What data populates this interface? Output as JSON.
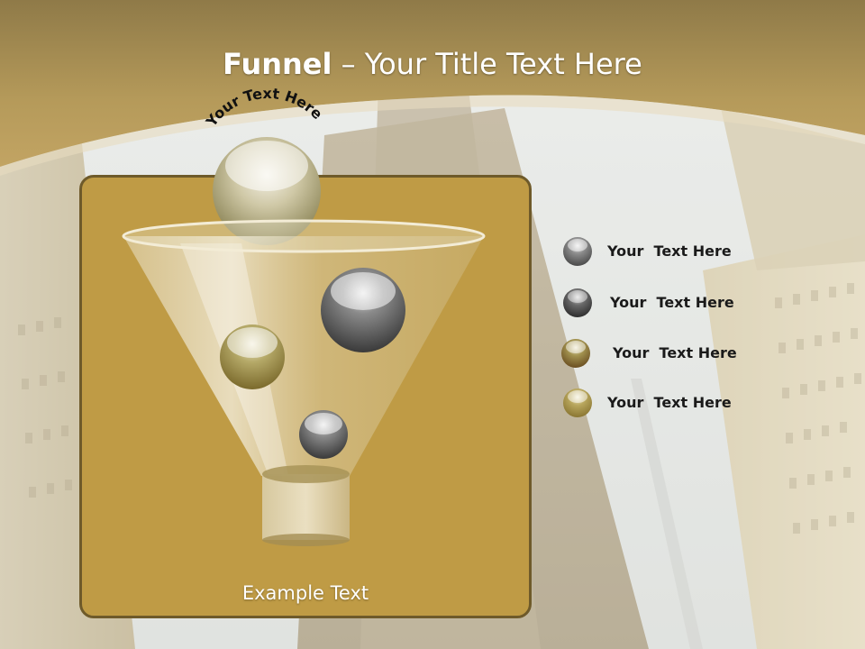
{
  "title": {
    "bold": "Funnel",
    "rest": " – Your Title Text Here"
  },
  "funnel": {
    "arc_text": "Your Text Here",
    "bottom_text": "Example Text"
  },
  "legend": [
    {
      "label": "Your  Text Here",
      "color": "#6e6e6e"
    },
    {
      "label": "Your  Text Here",
      "color": "#4a4a4a"
    },
    {
      "label": "Your  Text Here",
      "color": "#8a7a3a"
    },
    {
      "label": "Your  Text Here",
      "color": "#a8954a"
    }
  ],
  "colors": {
    "header_gold": "#b99a55",
    "panel_gold": "#bf9b45",
    "panel_border": "#6e5a2a"
  }
}
